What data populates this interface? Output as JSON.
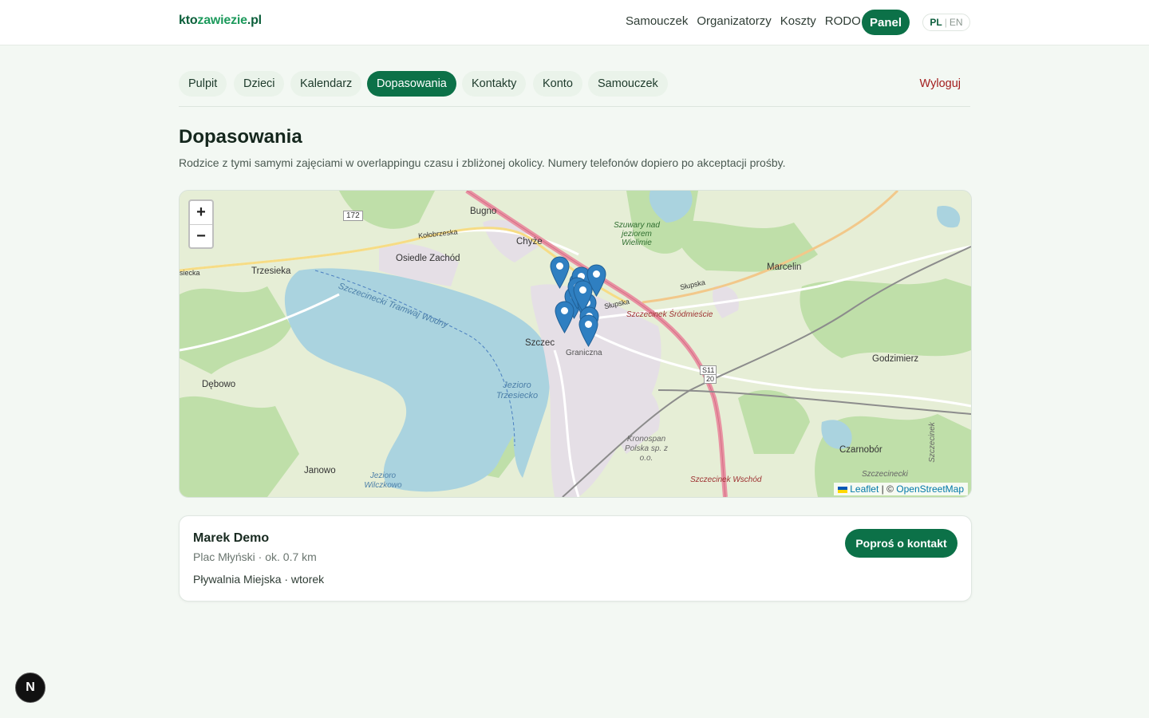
{
  "header": {
    "logo": {
      "part1": "kto",
      "part2": "zawiezie",
      "part3": ".pl"
    },
    "nav": [
      "Samouczek",
      "Organizatorzy",
      "Koszty",
      "RODO"
    ],
    "panel_label": "Panel",
    "lang": {
      "pl": "PL",
      "sep": "|",
      "en": "EN"
    }
  },
  "subnav": {
    "tabs": [
      "Pulpit",
      "Dzieci",
      "Kalendarz",
      "Dopasowania",
      "Kontakty",
      "Konto",
      "Samouczek"
    ],
    "active": "Dopasowania",
    "logout": "Wyloguj"
  },
  "page": {
    "title": "Dopasowania",
    "subtitle": "Rodzice z tymi samymi zajęciami w overlappingu czasu i zbliżonej okolicy. Numery telefonów dopiero po akceptacji prośby."
  },
  "map": {
    "zoom_in": "+",
    "zoom_out": "−",
    "attribution": {
      "leaflet": "Leaflet",
      "sep": "|",
      "copy": "©",
      "osm": "OpenStreetMap"
    },
    "labels": {
      "bugno": "Bugno",
      "chyze": "Chyże",
      "osiedle": "Osiedle Zachód",
      "trzesieka": "Trzesieka",
      "marcelin": "Marcelin",
      "godzimierz": "Godzimierz",
      "debowo": "Dębowo",
      "janowo": "Janowo",
      "czarnobor": "Czarnobór",
      "szczec": "Szczec",
      "road172": "172",
      "kolobrzeska": "Kołobrzeska",
      "slupska": "Słupska",
      "slupska2": "Słupska",
      "tramwaj": "Szczecinecki Tramwaj Wodny",
      "jezioro_t": "Jezioro Trzesiecko",
      "jezioro_w": "Jezioro Wilczkowo",
      "srodmiescie": "Szczecinek Śródmieście",
      "wschod": "Szczecinek Wschód",
      "szczecinecki": "Szczecinecki",
      "szczecinek_v": "Szczecinek",
      "kronospan": "Kronospan Polska sp. z o.o.",
      "s11": "S11",
      "s20": "20",
      "szuwary": "Szuwary nad jeziorem Wielimie",
      "granica": "Granicznа",
      "siecka": "siecka"
    }
  },
  "match": {
    "name": "Marek Demo",
    "location": "Plac Młyński · ok. 0.7 km",
    "activity": "Pływalnia Miejska · wtorek",
    "button": "Poproś o kontakt"
  },
  "colors": {
    "primary": "#0c7148",
    "danger": "#a21d1d",
    "marker": "#2f7fc1"
  },
  "badge": "N"
}
